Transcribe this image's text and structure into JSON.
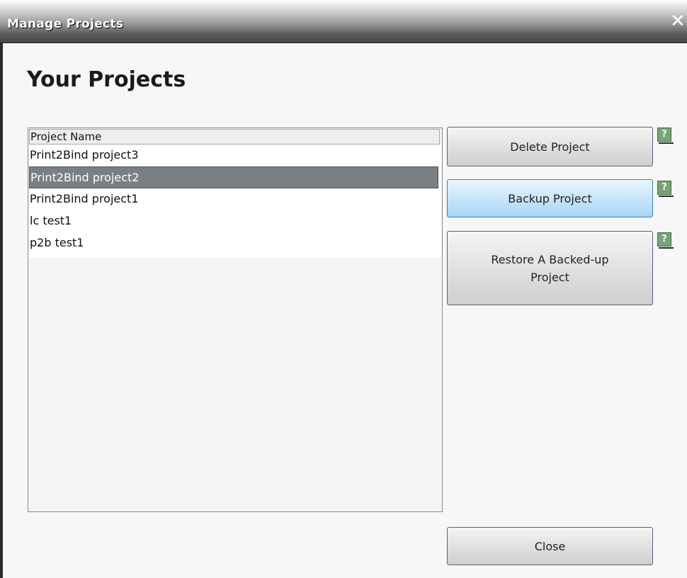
{
  "window": {
    "title": "Manage Projects",
    "close_glyph": "✕"
  },
  "heading": "Your Projects",
  "projects": {
    "column_header": "Project Name",
    "items": [
      {
        "name": "Print2Bind project3",
        "selected": false
      },
      {
        "name": "Print2Bind project2",
        "selected": true
      },
      {
        "name": "Print2Bind project1",
        "selected": false
      },
      {
        "name": "lc test1",
        "selected": false
      },
      {
        "name": "p2b test1",
        "selected": false
      }
    ]
  },
  "buttons": {
    "delete": "Delete Project",
    "backup": "Backup Project",
    "restore": "Restore A Backed-up Project",
    "close": "Close"
  },
  "help_glyph": "?",
  "colors": {
    "selection": "#7a7f84",
    "hover_button": "#c8e6fb",
    "help_icon": "#7aa37a"
  }
}
